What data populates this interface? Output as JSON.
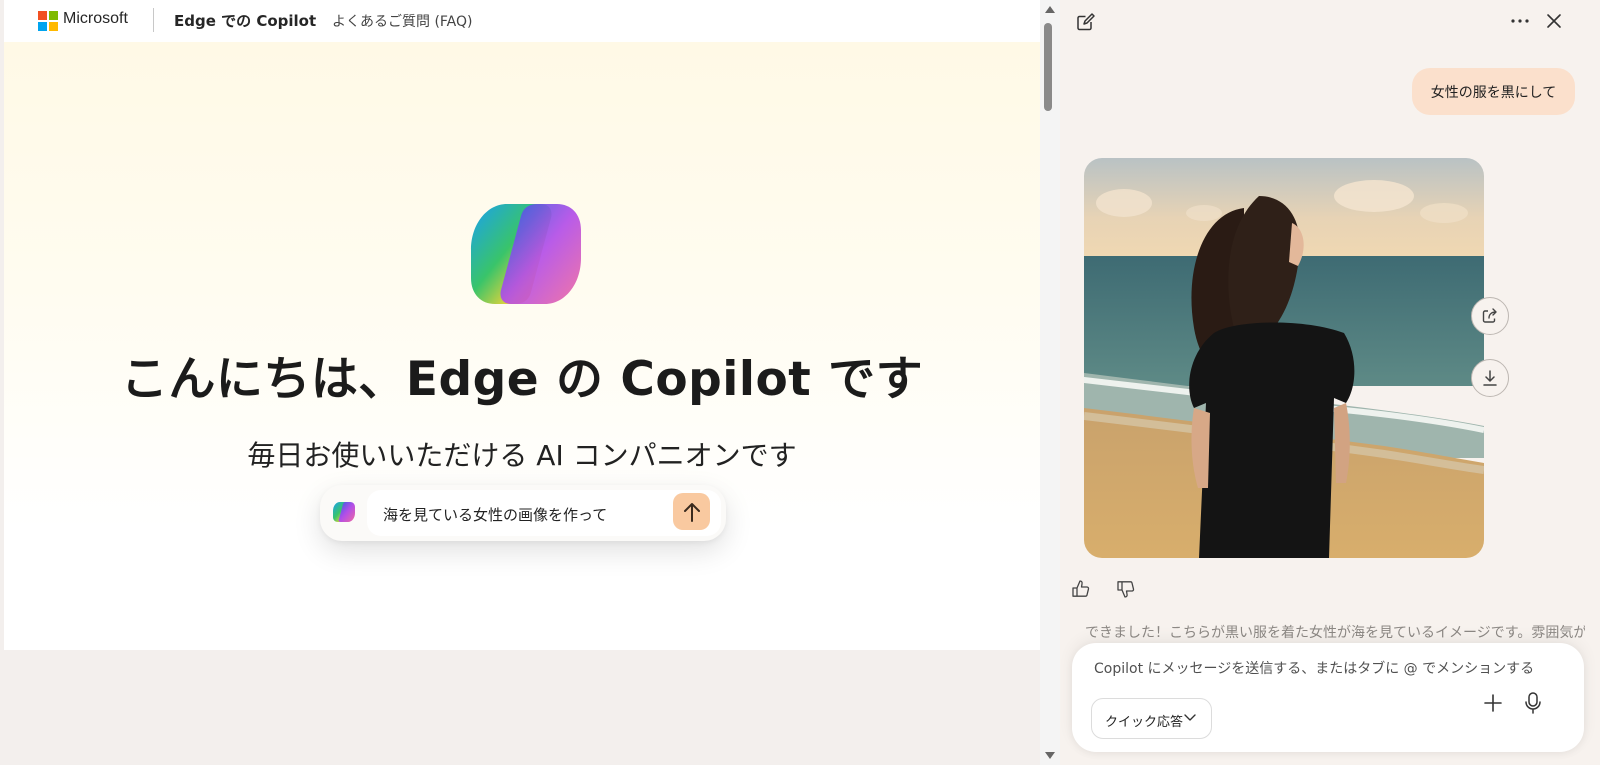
{
  "page": {
    "header": {
      "ms_brand": "Microsoft",
      "title": "Edge での Copilot",
      "faq_link": "よくあるご質問 (FAQ)"
    },
    "hero": {
      "heading": "こんにちは、Edge の Copilot です",
      "subheading": "毎日お使いいただける AI コンパニオンです"
    },
    "composer": {
      "prompt_text": "海を見ている女性の画像を作って"
    }
  },
  "panel": {
    "user_message": "女性の服を黒にして",
    "reply_text": "できました！こちらが黒い服を着た女性が海を見ているイメージです。雰囲気がぐっ",
    "input_placeholder": "Copilot にメッセージを送信する、またはタブに @ でメンションする",
    "mode_selector": "クイック応答"
  },
  "colors": {
    "accent": "#f9c9a0",
    "user_bubble": "#fbe0cc",
    "ms_red": "#f25022",
    "ms_green": "#7fba00",
    "ms_blue": "#00a4ef",
    "ms_yellow": "#ffb900"
  },
  "icons": [
    "new-chat-icon",
    "more-icon",
    "close-icon",
    "share-icon",
    "download-icon",
    "thumbs-up-icon",
    "thumbs-down-icon",
    "plus-icon",
    "microphone-icon",
    "send-arrow-icon",
    "chevron-down-icon"
  ]
}
